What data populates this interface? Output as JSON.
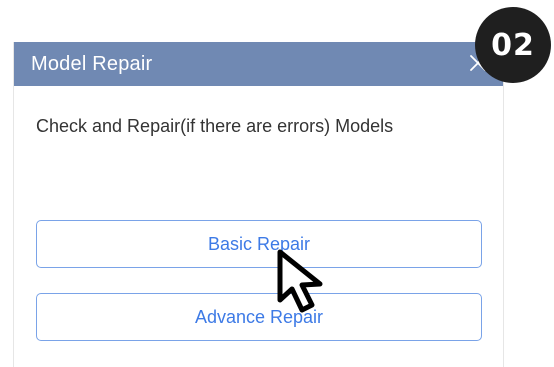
{
  "dialog": {
    "title": "Model Repair",
    "description": "Check and Repair(if there are errors) Models",
    "buttons": {
      "basic_repair": "Basic Repair",
      "advance_repair": "Advance Repair"
    },
    "close_icon": "close-icon"
  },
  "step_badge": "02",
  "cursor_icon": "mouse-pointer-icon",
  "colors": {
    "titlebar": "#7089b3",
    "button_border": "#7aa3e8",
    "button_text": "#3d7ae6",
    "badge": "#1f1f1f"
  }
}
